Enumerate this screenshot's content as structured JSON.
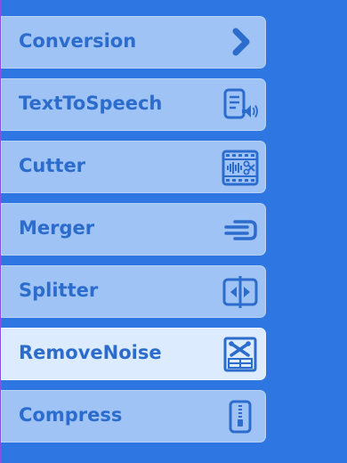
{
  "menu": {
    "items": [
      {
        "label": "Conversion",
        "icon": "chevron-right-icon",
        "active": false
      },
      {
        "label": "TextToSpeech",
        "icon": "text-to-speech-icon",
        "active": false
      },
      {
        "label": "Cutter",
        "icon": "audio-cutter-icon",
        "active": false
      },
      {
        "label": "Merger",
        "icon": "merge-icon",
        "active": false
      },
      {
        "label": "Splitter",
        "icon": "split-icon",
        "active": false
      },
      {
        "label": "RemoveNoise",
        "icon": "remove-noise-icon",
        "active": true
      },
      {
        "label": "Compress",
        "icon": "compress-icon",
        "active": false
      }
    ]
  },
  "colors": {
    "background": "#2e77e2",
    "item_background": "#9fc3f4",
    "active_item_background": "#dcebfd",
    "label_text": "#2b6ccc",
    "left_edge": "#8a4fe0"
  }
}
